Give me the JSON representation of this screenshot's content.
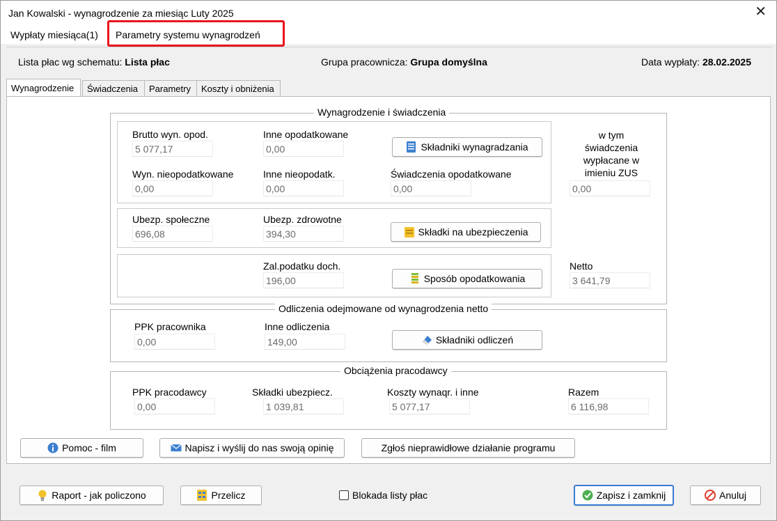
{
  "window": {
    "title": "Jan Kowalski - wynagrodzenie za miesiąc Luty 2025",
    "close_glyph": "✕"
  },
  "menu": {
    "items": [
      {
        "label": "Wypłaty miesiąca(1)"
      },
      {
        "label": "Parametry systemu wynagrodzeń"
      }
    ]
  },
  "info": {
    "schema_label": "Lista płac wg schematu:",
    "schema_value": "Lista płac",
    "group_label": "Grupa pracownicza:",
    "group_value": "Grupa domyślna",
    "date_label": "Data wypłaty:",
    "date_value": "28.02.2025"
  },
  "tabs": [
    {
      "label": "Wynagrodzenie"
    },
    {
      "label": "Świadczenia"
    },
    {
      "label": "Parametry"
    },
    {
      "label": "Koszty i obniżenia"
    }
  ],
  "salary": {
    "title": "Wynagrodzenie i świadczenia",
    "brutto_label": "Brutto wyn. opod.",
    "brutto_value": "5 077,17",
    "inne_opod_label": "Inne opodatkowane",
    "inne_opod_value": "0,00",
    "skladniki_button": "Składniki wynagradzania",
    "wyn_nieopod_label": "Wyn. nieopodatkowane",
    "wyn_nieopod_value": "0,00",
    "inne_nieopod_label": "Inne nieopodatk.",
    "inne_nieopod_value": "0,00",
    "swiad_opod_label": "Świadczenia opodatkowane",
    "swiad_opod_value": "0,00",
    "zus_label_1": "w tym",
    "zus_label_2": "świadczenia",
    "zus_label_3": "wypłacane w",
    "zus_label_4": "imieniu ZUS",
    "zus_value": "0,00",
    "ubezp_spol_label": "Ubezp. społeczne",
    "ubezp_spol_value": "696,08",
    "ubezp_zdrow_label": "Ubezp. zdrowotne",
    "ubezp_zdrow_value": "394,30",
    "skladki_button": "Składki na ubezpieczenia",
    "zal_label": "Zal.podatku doch.",
    "zal_value": "196,00",
    "sposob_button": "Sposób opodatkowania",
    "netto_label": "Netto",
    "netto_value": "3 641,79"
  },
  "deductions": {
    "title": "Odliczenia odejmowane od wynagrodzenia netto",
    "ppk_prac_label": "PPK pracownika",
    "ppk_prac_value": "0,00",
    "inne_odl_label": "Inne odliczenia",
    "inne_odl_value": "149,00",
    "skladniki_odl_button": "Składniki odliczeń"
  },
  "employer": {
    "title": "Obciążenia pracodawcy",
    "ppk_pracodawcy_label": "PPK pracodawcy",
    "ppk_pracodawcy_value": "0,00",
    "skladki_label": "Składki ubezpiecz.",
    "skladki_value": "1 039,81",
    "koszty_label": "Koszty wynaqr. i inne",
    "koszty_value": "5 077,17",
    "razem_label": "Razem",
    "razem_value": "6 116,98"
  },
  "help_buttons": {
    "pomoc": "Pomoc - film",
    "opinia": "Napisz i wyślij do nas swoją opinię",
    "zglos": "Zgłoś nieprawidłowe działanie programu"
  },
  "footer": {
    "raport": "Raport - jak policzono",
    "przelicz": "Przelicz",
    "blokada": "Blokada listy płac",
    "zapisz": "Zapisz i zamknij",
    "anuluj": "Anuluj"
  },
  "colors": {
    "highlight": "#e8141c",
    "primary_border": "#3b7bd4"
  }
}
